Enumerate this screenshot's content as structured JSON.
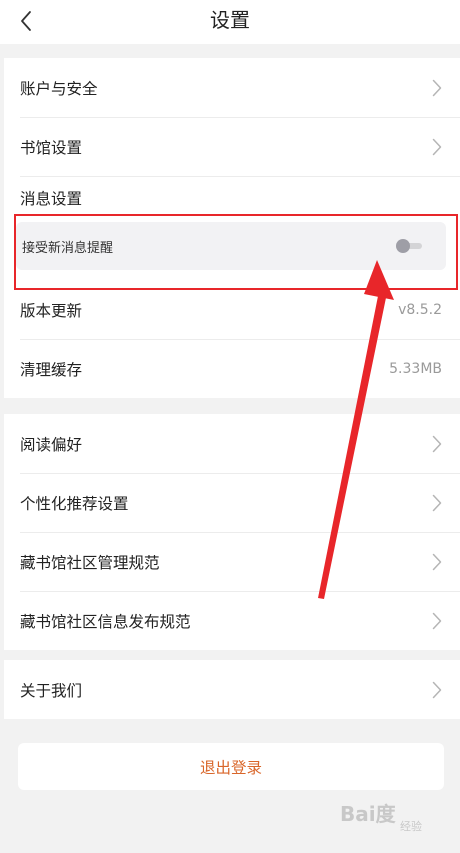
{
  "header": {
    "title": "设置"
  },
  "group1": {
    "account": "账户与安全",
    "library": "书馆设置",
    "message_title": "消息设置",
    "message_sub": "接受新消息提醒",
    "message_toggle_on": false,
    "version_label": "版本更新",
    "version_value": "v8.5.2",
    "cache_label": "清理缓存",
    "cache_value": "5.33MB"
  },
  "group2": {
    "items": [
      "阅读偏好",
      "个性化推荐设置",
      "藏书馆社区管理规范",
      "藏书馆社区信息发布规范"
    ]
  },
  "group3": {
    "about": "关于我们"
  },
  "logout": {
    "label": "退出登录"
  },
  "watermark": {
    "logo": "Bai度",
    "sub": "经验"
  },
  "colors": {
    "background": "#f2f2f2",
    "logout_text": "#d9662a",
    "annotation_red": "#e8262a",
    "toggle_knob": "#9e9ea6"
  },
  "icons": {
    "back": "chevron-left-icon",
    "row_arrow": "chevron-right-icon"
  }
}
